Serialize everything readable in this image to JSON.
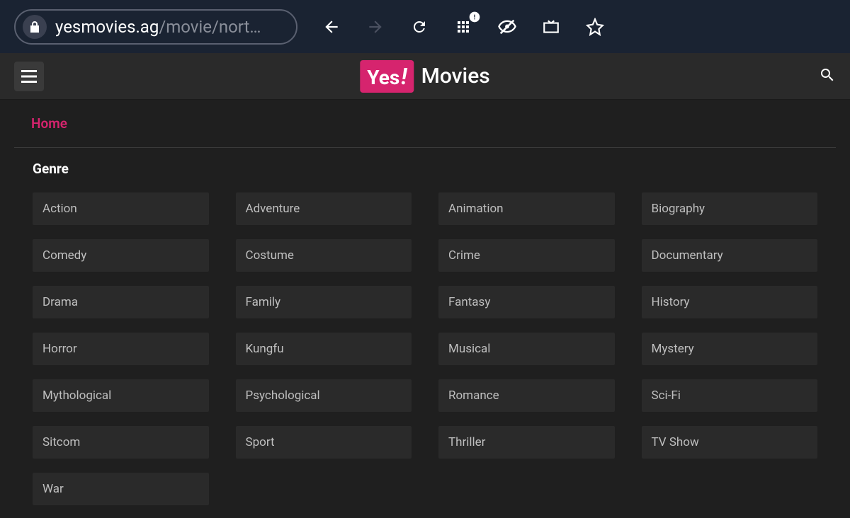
{
  "browser": {
    "url_domain": "yesmovies.ag",
    "url_path": "/movie/nort…"
  },
  "header": {
    "logo_badge": "Yes",
    "logo_exclaim": "!",
    "logo_text": "Movies"
  },
  "breadcrumb": {
    "home": "Home"
  },
  "genre": {
    "title": "Genre",
    "items": [
      "Action",
      "Adventure",
      "Animation",
      "Biography",
      "Comedy",
      "Costume",
      "Crime",
      "Documentary",
      "Drama",
      "Family",
      "Fantasy",
      "History",
      "Horror",
      "Kungfu",
      "Musical",
      "Mystery",
      "Mythological",
      "Psychological",
      "Romance",
      "Sci-Fi",
      "Sitcom",
      "Sport",
      "Thriller",
      "TV Show",
      "War"
    ]
  }
}
